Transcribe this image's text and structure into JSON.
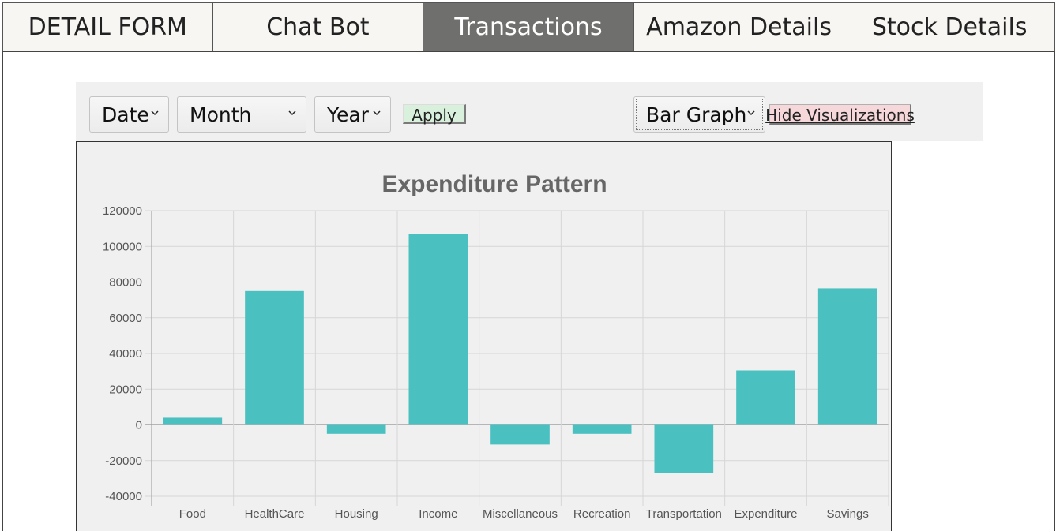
{
  "tabs": [
    {
      "label": "DETAIL FORM",
      "active": false
    },
    {
      "label": "Chat Bot",
      "active": false
    },
    {
      "label": "Transactions",
      "active": true
    },
    {
      "label": "Amazon Details",
      "active": false
    },
    {
      "label": "Stock Details",
      "active": false
    }
  ],
  "controls": {
    "date_label": "Date",
    "month_label": "Month",
    "year_label": "Year",
    "apply_label": "Apply",
    "graph_type_label": "Bar Graph",
    "hide_label": "Hide Visualizations"
  },
  "colors": {
    "bar": "#4bc0c0",
    "active_tab": "#6f6f6d",
    "apply_bg": "#d8f0dc",
    "hide_bg": "#f6d8da"
  },
  "chart_data": {
    "type": "bar",
    "title": "Expenditure Pattern",
    "xlabel": "",
    "ylabel": "",
    "categories": [
      "Food",
      "HealthCare",
      "Housing",
      "Income",
      "Miscellaneous",
      "Recreation",
      "Transportation",
      "Expenditure",
      "Savings"
    ],
    "values": [
      4000,
      75000,
      -5000,
      107000,
      -11000,
      -5000,
      -27000,
      30500,
      76500
    ],
    "ylim": [
      -40000,
      120000
    ],
    "yticks": [
      120000,
      100000,
      80000,
      60000,
      40000,
      20000,
      0,
      -20000,
      -40000
    ],
    "grid": true,
    "legend": "none"
  }
}
